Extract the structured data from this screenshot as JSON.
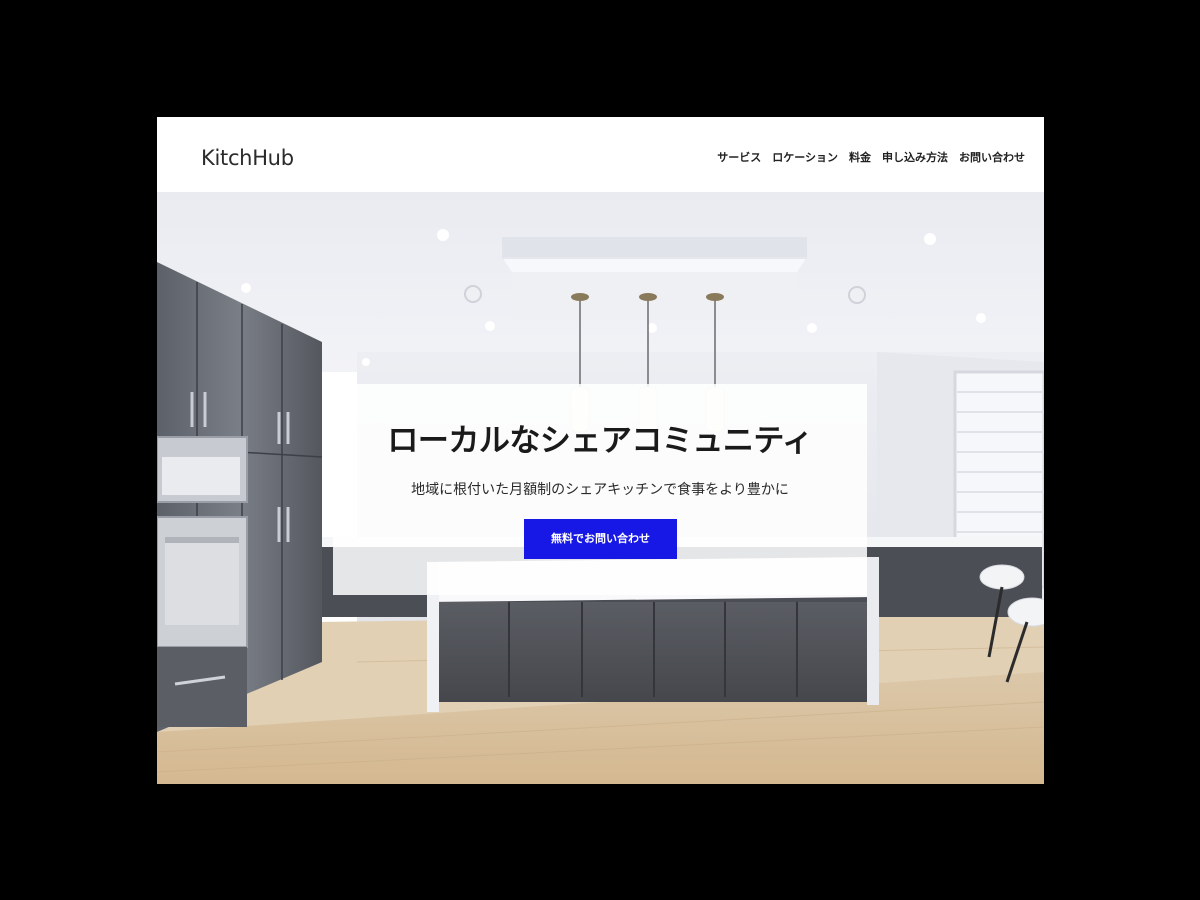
{
  "header": {
    "logo": "KitchHub",
    "nav": [
      {
        "label": "サービス"
      },
      {
        "label": "ロケーション"
      },
      {
        "label": "料金"
      },
      {
        "label": "申し込み方法"
      },
      {
        "label": "お問い合わせ"
      }
    ]
  },
  "hero": {
    "headline": "ローカルなシェアコミュニティ",
    "subheadline": "地域に根付いた月額制のシェアキッチンで食事をより豊かに",
    "cta_label": "無料でお問い合わせ"
  },
  "colors": {
    "cta_background": "#1717e6",
    "backdrop": "#000000",
    "header_background": "#ffffff"
  }
}
